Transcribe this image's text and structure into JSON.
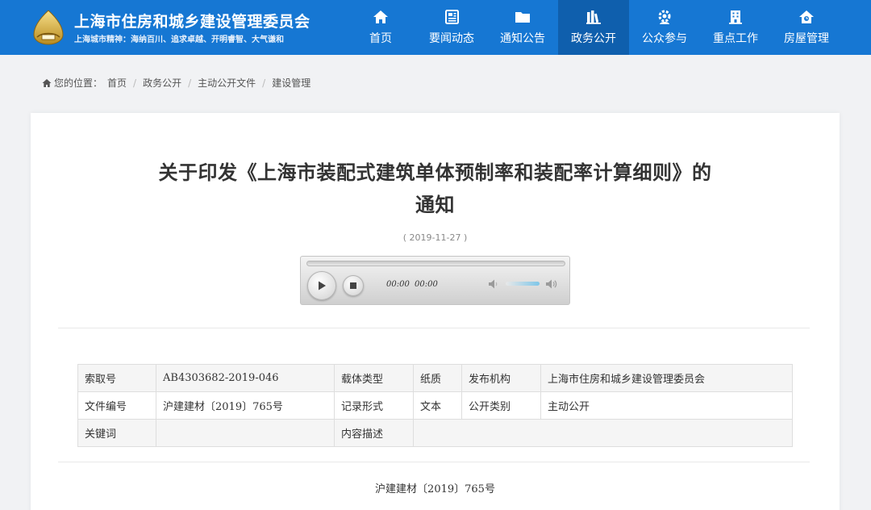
{
  "site": {
    "title": "上海市住房和城乡建设管理委员会",
    "motto": "上海城市精神：海纳百川、追求卓越、开明睿智、大气谦和"
  },
  "colors": {
    "header_bg": "#1677d3",
    "nav_active_bg": "#0f5fad"
  },
  "nav": {
    "items": [
      {
        "label": "首页",
        "icon": "home-icon"
      },
      {
        "label": "要闻动态",
        "icon": "news-icon"
      },
      {
        "label": "通知公告",
        "icon": "folder-icon"
      },
      {
        "label": "政务公开",
        "icon": "books-icon",
        "active": true
      },
      {
        "label": "公众参与",
        "icon": "people-gear-icon"
      },
      {
        "label": "重点工作",
        "icon": "building-icon"
      },
      {
        "label": "房屋管理",
        "icon": "house-icon"
      }
    ]
  },
  "breadcrumb": {
    "prefix": "您的位置：",
    "items": [
      "首页",
      "政务公开",
      "主动公开文件",
      "建设管理"
    ]
  },
  "article": {
    "title_line1": "关于印发《上海市装配式建筑单体预制率和装配率计算细则》的",
    "title_line2": "通知",
    "date": "( 2019-11-27 )",
    "doc_number": "沪建建材〔2019〕765号"
  },
  "player": {
    "current_time": "00:00",
    "duration": "00:00"
  },
  "info_table": {
    "rows": [
      [
        "索取号",
        "AB4303682-2019-046",
        "载体类型",
        "纸质",
        "发布机构",
        "上海市住房和城乡建设管理委员会"
      ],
      [
        "文件编号",
        "沪建建材〔2019〕765号",
        "记录形式",
        "文本",
        "公开类别",
        "主动公开"
      ],
      [
        "关键词",
        "",
        "内容描述",
        ""
      ]
    ]
  }
}
